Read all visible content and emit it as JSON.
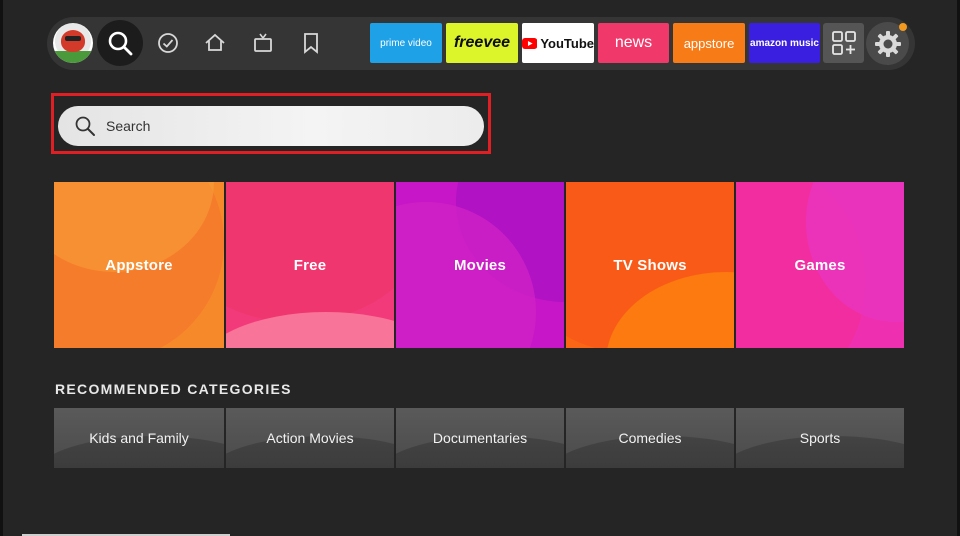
{
  "top_nav": {
    "apps": [
      {
        "name": "prime-video-tile",
        "label": "prime video",
        "bg": "#1ea1e6",
        "fg": "#ffffff"
      },
      {
        "name": "freevee-tile",
        "label": "freevee",
        "bg": "#dcf52a",
        "fg": "#0d0d0d"
      },
      {
        "name": "youtube-tile",
        "label": "YouTube",
        "bg": "#ffffff",
        "fg": "#111111"
      },
      {
        "name": "news-tile",
        "label": "news",
        "bg": "#f0386b",
        "fg": "#ffffff"
      },
      {
        "name": "appstore-tile",
        "label": "appstore",
        "bg": "#f77b16",
        "fg": "#ffffff"
      },
      {
        "name": "amazon-music-tile",
        "label": "amazon music",
        "bg": "#3b1fe0",
        "fg": "#ffffff"
      }
    ],
    "settings_notification_color": "#f39a1e"
  },
  "search": {
    "placeholder": "Search",
    "focus_color": "#e01f25"
  },
  "categories": [
    {
      "label": "Appstore",
      "color": "#f6892a"
    },
    {
      "label": "Free",
      "color": "#f23a7a"
    },
    {
      "label": "Movies",
      "color": "#c616c8"
    },
    {
      "label": "TV Shows",
      "color": "#fb6616"
    },
    {
      "label": "Games",
      "color": "#ee30b0"
    }
  ],
  "recommended": {
    "title": "RECOMMENDED CATEGORIES",
    "items": [
      {
        "label": "Kids and Family"
      },
      {
        "label": "Action Movies"
      },
      {
        "label": "Documentaries"
      },
      {
        "label": "Comedies"
      },
      {
        "label": "Sports"
      }
    ]
  }
}
